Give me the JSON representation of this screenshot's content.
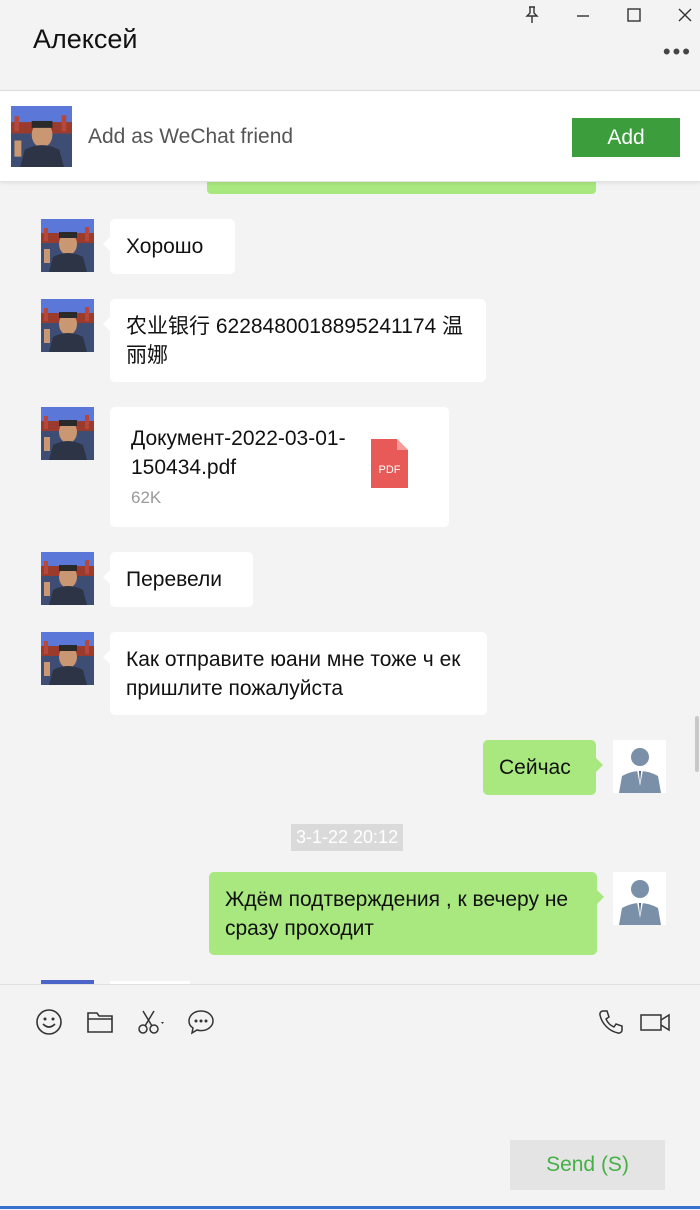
{
  "window": {
    "title": "Алексей"
  },
  "friend_bar": {
    "text": "Add as WeChat friend",
    "add_label": "Add"
  },
  "messages": [
    {
      "side": "in",
      "text": "Хорошо"
    },
    {
      "side": "in",
      "text": "农业银行 6228480018895241174 温丽娜"
    },
    {
      "side": "in",
      "type": "file",
      "file_name": "Документ-2022-03-01-150434.pdf",
      "file_size": "62K",
      "icon_label": "PDF"
    },
    {
      "side": "in",
      "text": "Перевели"
    },
    {
      "side": "in",
      "text": "Как отправите юани мне тоже ч ек пришлите пожалуйста"
    },
    {
      "side": "out",
      "text": "Сейчас"
    },
    {
      "type": "timestamp",
      "text": "3-1-22 20:12"
    },
    {
      "side": "out",
      "text": "Ждём подтверждения , к вечеру не сразу проходит"
    }
  ],
  "composer": {
    "send_label": "Send (S)"
  },
  "colors": {
    "accent_green": "#3b9d3b",
    "bubble_green": "#a8e87f",
    "send_text": "#45b045"
  },
  "icons": [
    "pin-icon",
    "minimize-icon",
    "maximize-icon",
    "close-icon",
    "more-icon",
    "emoji-icon",
    "folder-icon",
    "scissors-icon",
    "chat-history-icon",
    "phone-icon",
    "video-icon",
    "pdf-icon"
  ]
}
